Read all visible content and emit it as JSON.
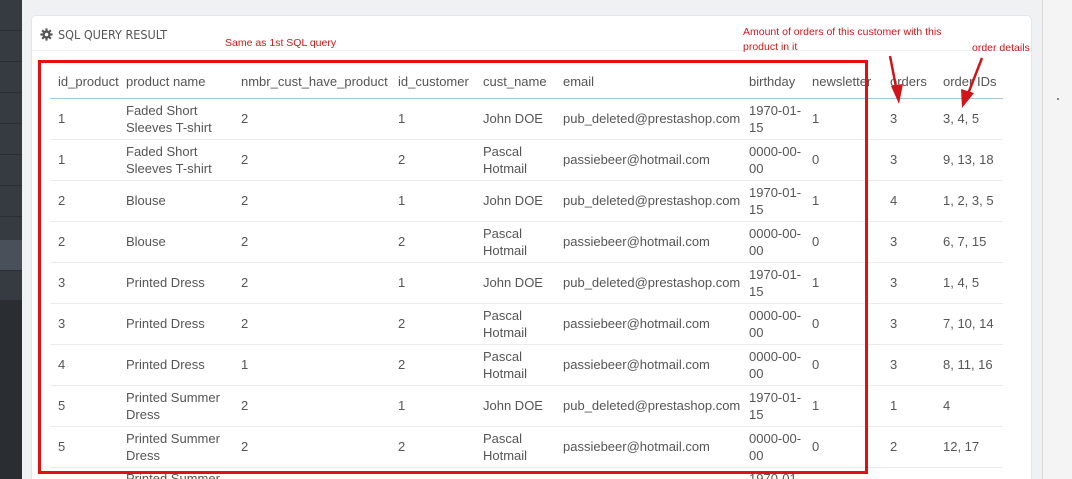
{
  "panel": {
    "title": "SQL QUERY RESULT",
    "icon": "gear-icon"
  },
  "annotations": {
    "same_query": "Same as 1st SQL query",
    "amount_orders": "Amount of orders of this customer with this product in it",
    "order_details": "order details",
    "color": "#d0161a"
  },
  "table": {
    "columns": [
      "id_product",
      "product name",
      "nmbr_cust_have_product",
      "id_customer",
      "cust_name",
      "email",
      "birthday",
      "newsletter",
      "orders",
      "order IDs"
    ],
    "rows": [
      [
        "1",
        "Faded Short Sleeves T-shirt",
        "2",
        "1",
        "John DOE",
        "pub_deleted@prestashop.com",
        "1970-01-15",
        "1",
        "3",
        "3, 4, 5"
      ],
      [
        "1",
        "Faded Short Sleeves T-shirt",
        "2",
        "2",
        "Pascal Hotmail",
        "passiebeer@hotmail.com",
        "0000-00-00",
        "0",
        "3",
        "9, 13, 18"
      ],
      [
        "2",
        "Blouse",
        "2",
        "1",
        "John DOE",
        "pub_deleted@prestashop.com",
        "1970-01-15",
        "1",
        "4",
        "1, 2, 3, 5"
      ],
      [
        "2",
        "Blouse",
        "2",
        "2",
        "Pascal Hotmail",
        "passiebeer@hotmail.com",
        "0000-00-00",
        "0",
        "3",
        "6, 7, 15"
      ],
      [
        "3",
        "Printed Dress",
        "2",
        "1",
        "John DOE",
        "pub_deleted@prestashop.com",
        "1970-01-15",
        "1",
        "3",
        "1, 4, 5"
      ],
      [
        "3",
        "Printed Dress",
        "2",
        "2",
        "Pascal Hotmail",
        "passiebeer@hotmail.com",
        "0000-00-00",
        "0",
        "3",
        "7, 10, 14"
      ],
      [
        "4",
        "Printed Dress",
        "1",
        "2",
        "Pascal Hotmail",
        "passiebeer@hotmail.com",
        "0000-00-00",
        "0",
        "3",
        "8, 11, 16"
      ],
      [
        "5",
        "Printed Summer Dress",
        "2",
        "1",
        "John DOE",
        "pub_deleted@prestashop.com",
        "1970-01-15",
        "1",
        "1",
        "4"
      ],
      [
        "5",
        "Printed Summer Dress",
        "2",
        "2",
        "Pascal Hotmail",
        "passiebeer@hotmail.com",
        "0000-00-00",
        "0",
        "2",
        "12, 17"
      ]
    ],
    "partial_row": [
      "",
      "Printed Summer",
      "",
      "",
      "",
      "",
      "1970-01-",
      "",
      "",
      ""
    ]
  }
}
